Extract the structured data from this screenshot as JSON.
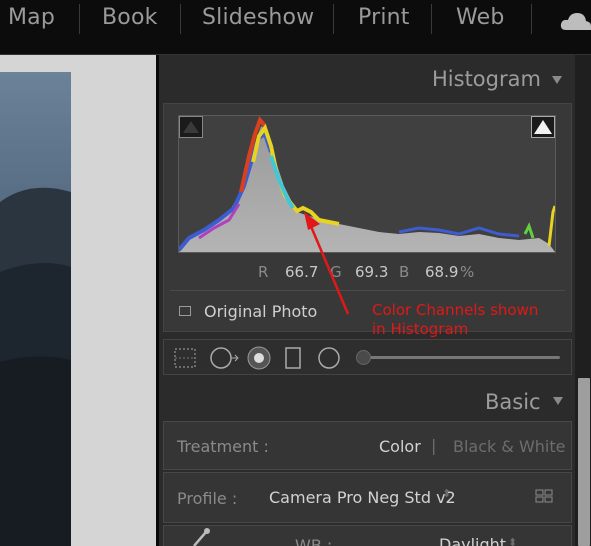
{
  "modules": [
    "Map",
    "Book",
    "Slideshow",
    "Print",
    "Web"
  ],
  "histogram": {
    "title": "Histogram",
    "r_label": "R",
    "r_value": "66.7",
    "g_label": "G",
    "g_value": "69.3",
    "b_label": "B",
    "b_value": "68.9",
    "percent": "%",
    "original_photo": "Original Photo"
  },
  "annotation": {
    "line1": "Color Channels shown",
    "line2": "in Histogram",
    "color": "#e21818"
  },
  "basic": {
    "title": "Basic",
    "treatment_label": "Treatment :",
    "treatment_color": "Color",
    "treatment_divider": "|",
    "treatment_bw": "Black & White",
    "profile_label": "Profile :",
    "profile_value": "Camera Pro Neg Std v2",
    "wb_label": "WB :",
    "wb_value": "Daylight"
  },
  "icons": {
    "cloud": "cloud-icon",
    "collapse": "triangle-down-icon",
    "shadow_clip": "shadow-clipping-icon",
    "highlight_clip": "highlight-clipping-icon",
    "crop": "crop-overlay-icon",
    "spot": "spot-removal-icon",
    "redeye": "red-eye-icon",
    "graduated": "graduated-filter-icon",
    "radial": "radial-filter-icon",
    "brush": "adjustment-brush-icon",
    "grid": "profile-browser-icon",
    "eyedropper": "white-balance-selector-icon"
  }
}
